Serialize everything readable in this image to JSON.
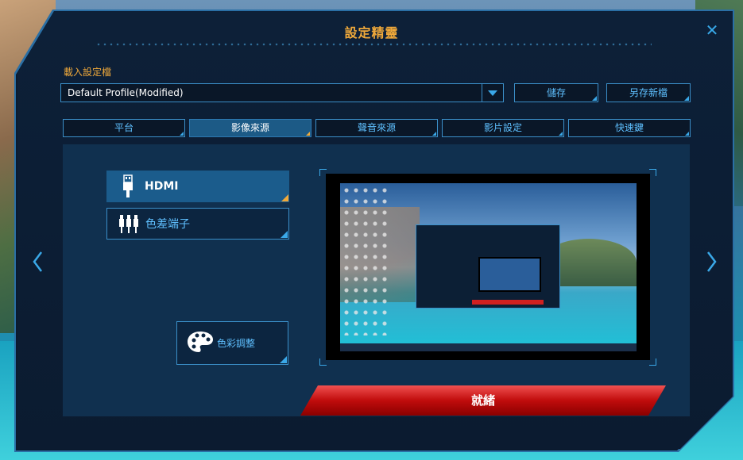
{
  "window": {
    "title": "設定精靈",
    "close_symbol": "✕"
  },
  "profile": {
    "label": "載入設定檔",
    "selected": "Default Profile(Modified)",
    "save_label": "儲存",
    "save_as_label": "另存新檔"
  },
  "tabs": [
    {
      "label": "平台",
      "active": false
    },
    {
      "label": "影像來源",
      "active": true
    },
    {
      "label": "聲音來源",
      "active": false
    },
    {
      "label": "影片設定",
      "active": false
    },
    {
      "label": "快速鍵",
      "active": false
    }
  ],
  "sources": [
    {
      "label": "HDMI",
      "icon": "hdmi-plug-icon",
      "active": true
    },
    {
      "label": "色差端子",
      "icon": "component-rca-icon",
      "active": false
    }
  ],
  "color_adjust": {
    "label": "色彩調整",
    "icon": "palette-icon"
  },
  "ready_button": {
    "label": "就緒"
  },
  "colors": {
    "accent_orange": "#f0a93a",
    "accent_blue": "#3aa8e8",
    "ready_red": "#c00c0c",
    "panel_bg": "#10304f"
  }
}
